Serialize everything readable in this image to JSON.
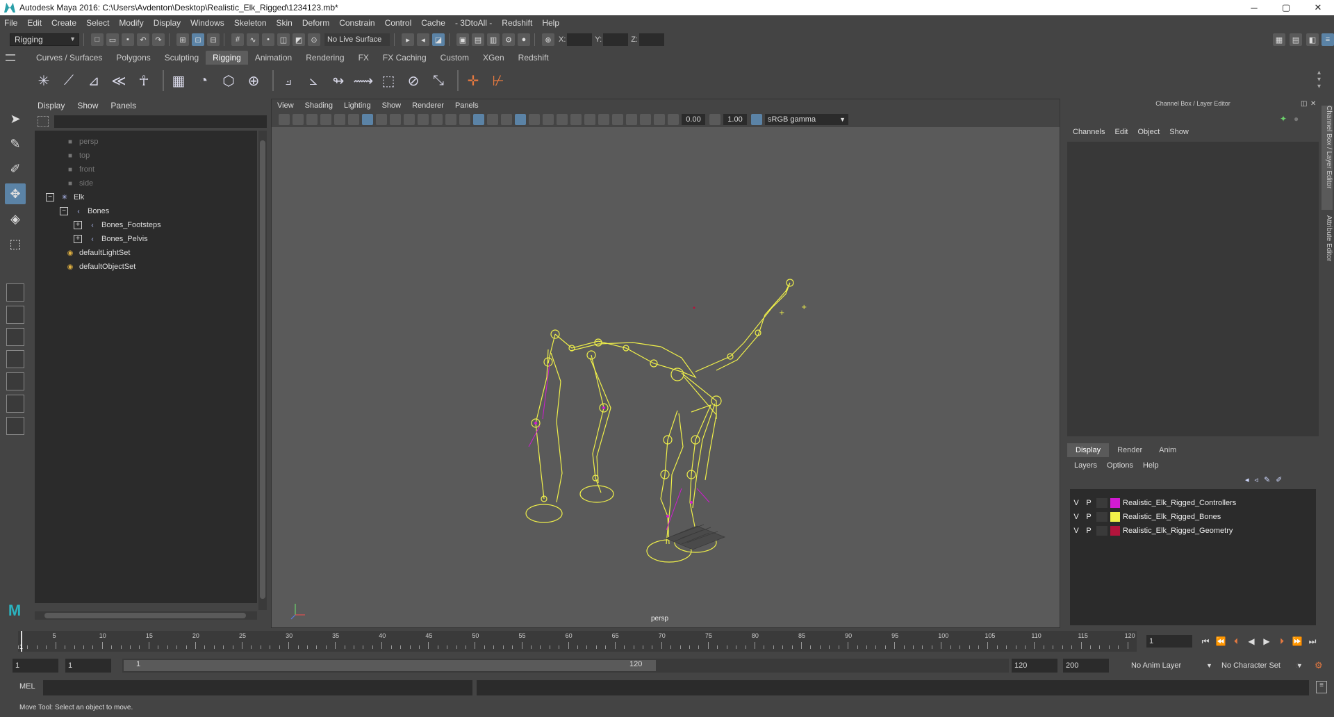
{
  "window": {
    "title": "Autodesk Maya 2016: C:\\Users\\Avdenton\\Desktop\\Realistic_Elk_Rigged\\1234123.mb*",
    "controls": [
      "─",
      "▢",
      "✕"
    ]
  },
  "menubar": [
    "File",
    "Edit",
    "Create",
    "Select",
    "Modify",
    "Display",
    "Windows",
    "Skeleton",
    "Skin",
    "Deform",
    "Constrain",
    "Control",
    "Cache",
    "- 3DtoAll -",
    "Redshift",
    "Help"
  ],
  "statusline": {
    "mode": "Rigging",
    "live_surface": "No Live Surface",
    "x_label": "X:",
    "y_label": "Y:",
    "z_label": "Z:"
  },
  "shelf": {
    "tabs": [
      "Curves / Surfaces",
      "Polygons",
      "Sculpting",
      "Rigging",
      "Animation",
      "Rendering",
      "FX",
      "FX Caching",
      "Custom",
      "XGen",
      "Redshift"
    ],
    "active_tab": "Rigging"
  },
  "outliner": {
    "menu": [
      "Display",
      "Show",
      "Panels"
    ],
    "items": [
      "persp",
      "top",
      "front",
      "side",
      "Elk",
      "Bones",
      "Bones_Footsteps",
      "Bones_Pelvis",
      "defaultLightSet",
      "defaultObjectSet"
    ]
  },
  "viewport": {
    "menu": [
      "View",
      "Shading",
      "Lighting",
      "Show",
      "Renderer",
      "Panels"
    ],
    "exposure": "0.00",
    "gamma_value": "1.00",
    "color_space": "sRGB gamma",
    "camera_label": "persp"
  },
  "channelbox": {
    "title": "Channel Box / Layer Editor",
    "menu": [
      "Channels",
      "Edit",
      "Object",
      "Show"
    ],
    "layer_tabs": [
      "Display",
      "Render",
      "Anim"
    ],
    "layer_menu": [
      "Layers",
      "Options",
      "Help"
    ],
    "layers": [
      {
        "v": "V",
        "p": "P",
        "name": "Realistic_Elk_Rigged_Controllers",
        "color": "#d21bd2"
      },
      {
        "v": "V",
        "p": "P",
        "name": "Realistic_Elk_Rigged_Bones",
        "color": "#f0f04a"
      },
      {
        "v": "V",
        "p": "P",
        "name": "Realistic_Elk_Rigged_Geometry",
        "color": "#b3143c"
      }
    ],
    "side_tabs": [
      "Channel Box / Layer Editor",
      "Attribute Editor"
    ]
  },
  "timeslider": {
    "ticks": [
      "5",
      "10",
      "15",
      "20",
      "25",
      "30",
      "35",
      "40",
      "45",
      "50",
      "55",
      "60",
      "65",
      "70",
      "75",
      "80",
      "85",
      "90",
      "95",
      "100",
      "105",
      "110",
      "115",
      "120"
    ],
    "current_frame": "1",
    "current_field": "1"
  },
  "rangeslider": {
    "start": "1",
    "playback_start": "1",
    "bar_start": "1",
    "bar_end": "120",
    "playback_end": "120",
    "end": "200",
    "anim_layer": "No Anim Layer",
    "character_set": "No Character Set"
  },
  "cmdline": {
    "label": "MEL"
  },
  "helpline": {
    "text": "Move Tool: Select an object to move."
  }
}
